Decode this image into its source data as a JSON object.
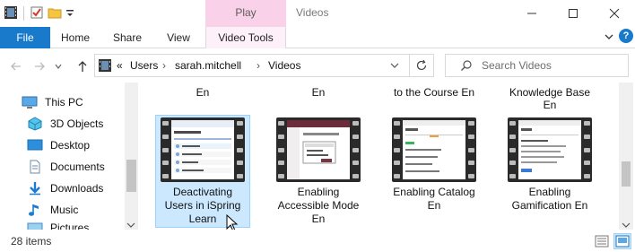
{
  "window": {
    "title": "Videos",
    "contextual_tab_group": "Play",
    "accent_color": "#1979ca",
    "context_color": "#f9d2ea"
  },
  "ribbon": {
    "tabs": [
      "File",
      "Home",
      "Share",
      "View",
      "Video Tools"
    ],
    "help": "?"
  },
  "address": {
    "overflow": "«",
    "crumbs": [
      "Users",
      "sarah.mitchell",
      "Videos"
    ],
    "search_placeholder": "Search Videos"
  },
  "nav": {
    "items": [
      {
        "label": "This PC",
        "icon": "this-pc-icon"
      },
      {
        "label": "3D Objects",
        "icon": "3d-objects-icon"
      },
      {
        "label": "Desktop",
        "icon": "desktop-icon"
      },
      {
        "label": "Documents",
        "icon": "documents-icon"
      },
      {
        "label": "Downloads",
        "icon": "downloads-icon"
      },
      {
        "label": "Music",
        "icon": "music-icon"
      },
      {
        "label": "Pictures",
        "icon": "pictures-icon"
      }
    ]
  },
  "content": {
    "top_row_labels": [
      "En",
      "En",
      "to the Course En",
      "Knowledge Base\nEn"
    ],
    "items": [
      {
        "name": "Deactivating Users in iSpring Learn",
        "lines": [
          "Deactivating",
          "Users in iSpring",
          "Learn"
        ],
        "selected": true
      },
      {
        "name": "Enabling Accessible Mode En",
        "lines": [
          "Enabling",
          "Accessible Mode",
          "En"
        ],
        "selected": false
      },
      {
        "name": "Enabling Catalog En",
        "lines": [
          "Enabling Catalog",
          "En"
        ],
        "selected": false
      },
      {
        "name": "Enabling Gamification En",
        "lines": [
          "Enabling",
          "Gamification En"
        ],
        "selected": false
      }
    ]
  },
  "status": {
    "item_count": "28 items"
  }
}
